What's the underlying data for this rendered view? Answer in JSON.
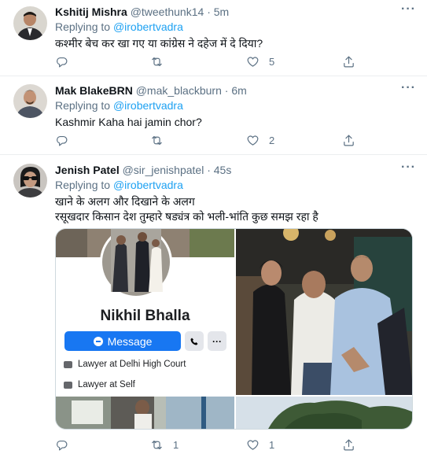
{
  "tweets": [
    {
      "name": "Kshitij Mishra",
      "handle": "@tweethunk14",
      "time": "5m",
      "reply_prefix": "Replying to",
      "reply_to": "@irobertvadra",
      "text": "कश्मीर बेच कर खा गए या कांग्रेस ने दहेज में दे दिया?",
      "replies": "",
      "retweets": "",
      "likes": "5"
    },
    {
      "name": "Mak BlakeBRN",
      "handle": "@mak_blackburn",
      "time": "6m",
      "reply_prefix": "Replying to",
      "reply_to": "@irobertvadra",
      "text": "Kashmir Kaha hai jamin chor?",
      "replies": "",
      "retweets": "",
      "likes": "2"
    },
    {
      "name": "Jenish Patel",
      "handle": "@sir_jenishpatel",
      "time": "45s",
      "reply_prefix": "Replying to",
      "reply_to": "@irobertvadra",
      "text_line1": "खाने के अलग और दिखाने के अलग",
      "text_line2": " रसूखदार किसान देश तुम्हारे षड्यंत्र को भली-भांति कुछ समझ रहा है",
      "replies": "",
      "retweets": "1",
      "likes": "1"
    }
  ],
  "media": {
    "profile_name": "Nikhil Bhalla",
    "message_button": "Message",
    "info_line1": "Lawyer at Delhi High Court",
    "info_line2": "Lawyer at Self"
  },
  "separator": "·",
  "more_glyph": "···",
  "colors": {
    "accent": "#1da1f2",
    "muted": "#5b7083",
    "border": "#ebeef0",
    "fb_blue": "#1877f2"
  }
}
